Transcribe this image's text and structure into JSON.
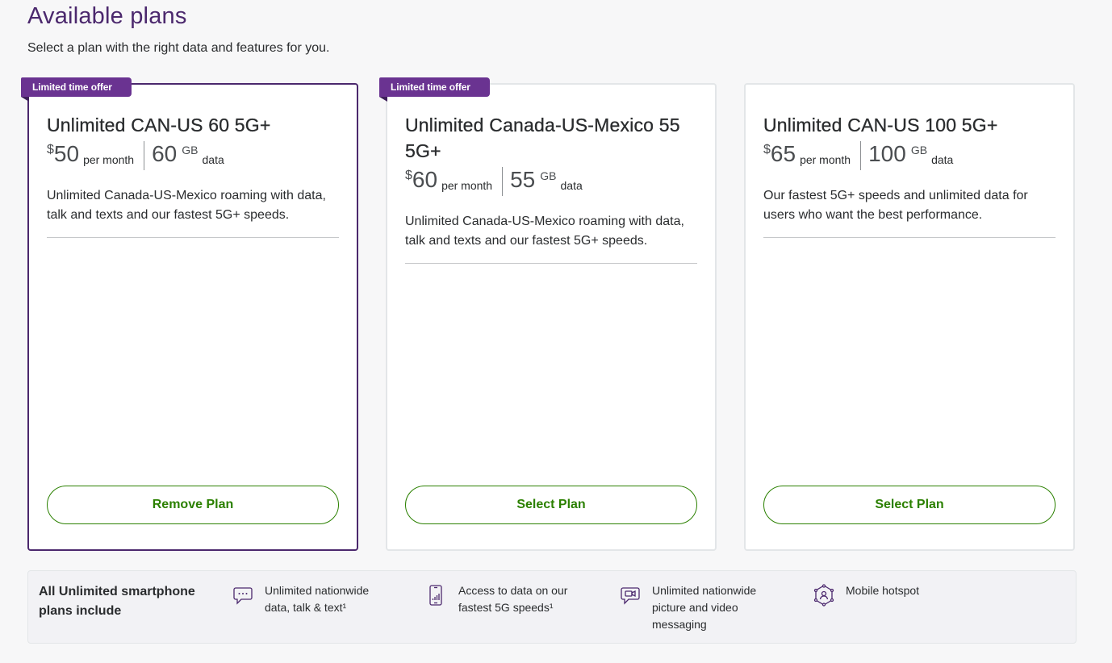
{
  "page": {
    "title": "Available plans",
    "subtitle": "Select a plan with the right data and features for you."
  },
  "plans": [
    {
      "badge": "Limited time offer",
      "name": "Unlimited CAN-US 60 5G+",
      "currency": "$",
      "price": "50",
      "price_unit": "per month",
      "data_amount": "60",
      "data_unit": "GB",
      "data_label": "data",
      "description": "Unlimited Canada-US-Mexico roaming with data, talk and texts and our fastest 5G+ speeds.",
      "button_label": "Remove Plan",
      "selected": true
    },
    {
      "badge": "Limited time offer",
      "name": "Unlimited Canada-US-Mexico 55 5G+",
      "currency": "$",
      "price": "60",
      "price_unit": "per month",
      "data_amount": "55",
      "data_unit": "GB",
      "data_label": "data",
      "description": "Unlimited Canada-US-Mexico roaming with data, talk and texts and our fastest 5G+ speeds.",
      "button_label": "Select Plan",
      "selected": false
    },
    {
      "name": "Unlimited CAN-US 100 5G+",
      "currency": "$",
      "price": "65",
      "price_unit": "per month",
      "data_amount": "100",
      "data_unit": "GB",
      "data_label": "data",
      "description": "Our fastest 5G+ speeds and unlimited data for users who want the best performance.",
      "button_label": "Select Plan",
      "selected": false
    }
  ],
  "includes": {
    "title": "All Unlimited smartphone plans include",
    "features": [
      {
        "icon": "chat-bubble-icon",
        "text": "Unlimited nationwide data, talk & text¹"
      },
      {
        "icon": "phone-signal-icon",
        "text": "Access to data on our fastest 5G speeds¹"
      },
      {
        "icon": "video-message-icon",
        "text": "Unlimited nationwide picture and video messaging"
      },
      {
        "icon": "hotspot-icon",
        "text": "Mobile hotspot"
      }
    ]
  },
  "colors": {
    "brand_purple": "#4b286d",
    "badge_purple": "#6a3391",
    "action_green": "#2b8000"
  }
}
